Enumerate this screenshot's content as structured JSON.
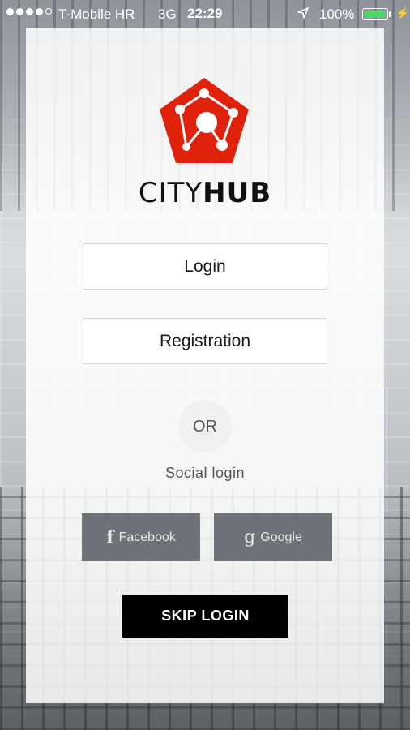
{
  "status_bar": {
    "carrier": "T-Mobile HR",
    "network": "3G",
    "time": "22:29",
    "battery_percent": "100%",
    "battery_color": "#4cd964"
  },
  "brand": {
    "name_light": "CITY",
    "name_bold": "HUB",
    "logo_color": "#e0220c"
  },
  "buttons": {
    "login": "Login",
    "registration": "Registration",
    "or": "OR",
    "social_label": "Social login",
    "facebook": "Facebook",
    "facebook_icon": "f",
    "google": "Google",
    "google_icon": "g",
    "skip": "SKIP LOGIN"
  }
}
